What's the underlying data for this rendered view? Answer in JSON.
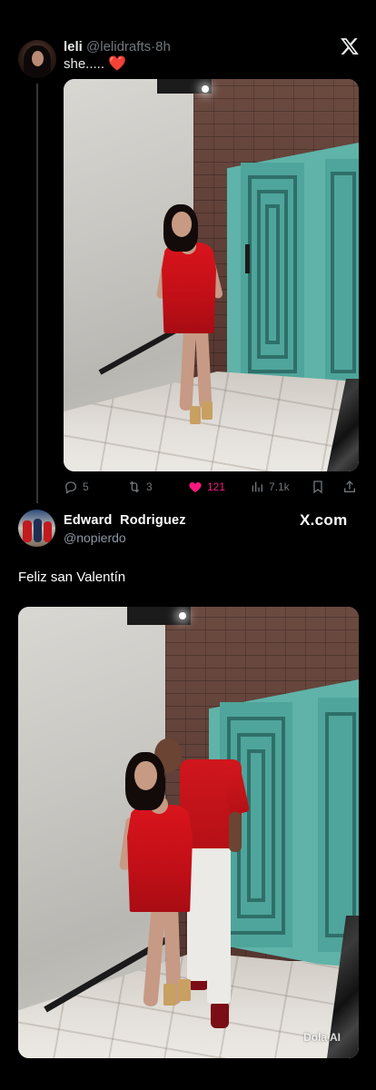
{
  "tweet1": {
    "display_name": "leli",
    "handle": "@lelidrafts",
    "separator": "·",
    "time": "8h",
    "text": "she.....",
    "emoji": "❤️",
    "actions": {
      "replies": "5",
      "retweets": "3",
      "likes": "121",
      "views": "7.1k"
    },
    "liked": true,
    "icons": [
      "x-logo-icon",
      "reply-icon",
      "retweet-icon",
      "heart-icon",
      "views-icon",
      "bookmark-icon",
      "share-icon"
    ]
  },
  "tweet2": {
    "display_name": "Edward  Rodriguez",
    "handle": "@nopierdo",
    "brand_text": "X.com",
    "text": "Feliz san Valentín",
    "watermark": "Dola AI"
  },
  "colors": {
    "background": "#000000",
    "like_pink": "#f91880",
    "muted_gray": "#71767b",
    "door_teal": "#5fb3a9",
    "dress_red": "#d9141c"
  }
}
